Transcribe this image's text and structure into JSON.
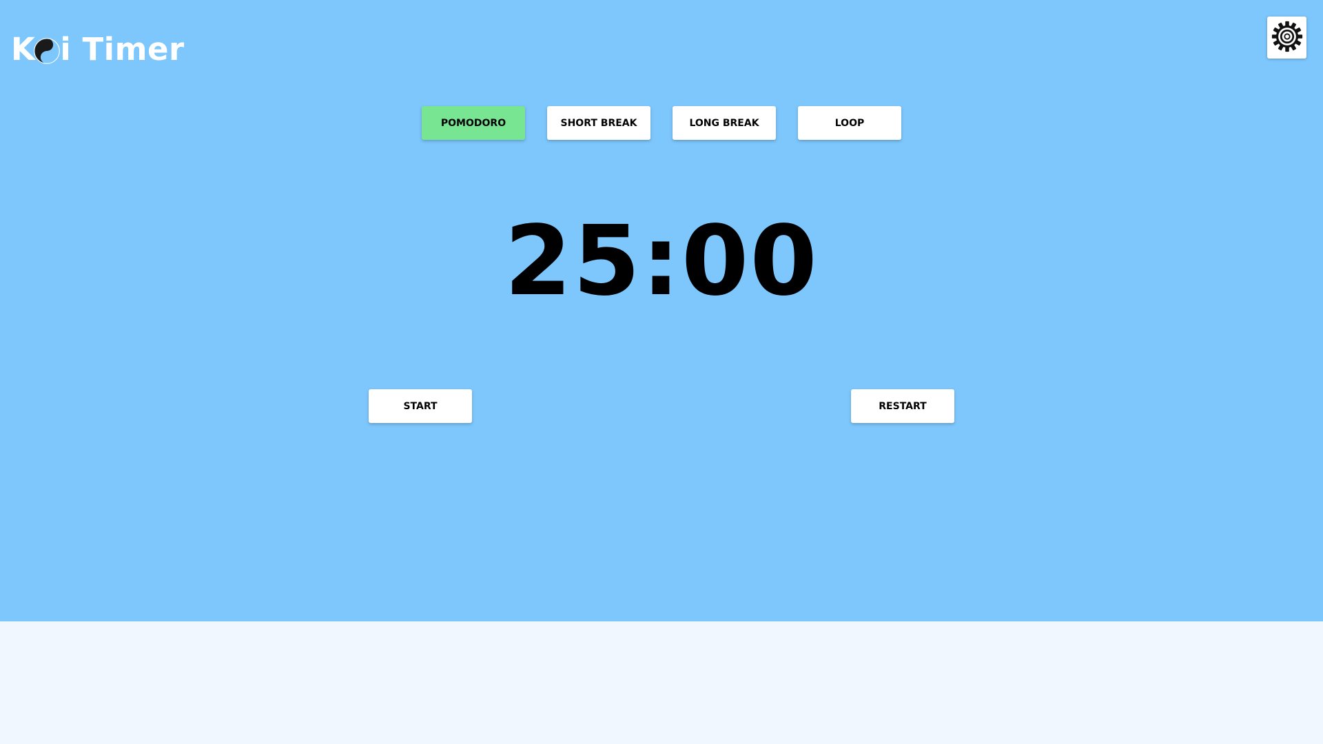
{
  "app": {
    "title_part1": "K",
    "title_part2": "i Timer",
    "background_color": "#7dc7fd",
    "footer_color": "#f0f7ff",
    "accent_active": "#77e592"
  },
  "header": {
    "logo_icon": "yin-yang-icon",
    "settings_icon": "gear-icon"
  },
  "modes": {
    "pomodoro": "POMODORO",
    "short_break": "SHORT BREAK",
    "long_break": "LONG BREAK",
    "loop": "LOOP",
    "active": "POMODORO"
  },
  "timer": {
    "display": "25:00"
  },
  "controls": {
    "start": "START",
    "restart": "RESTART"
  }
}
